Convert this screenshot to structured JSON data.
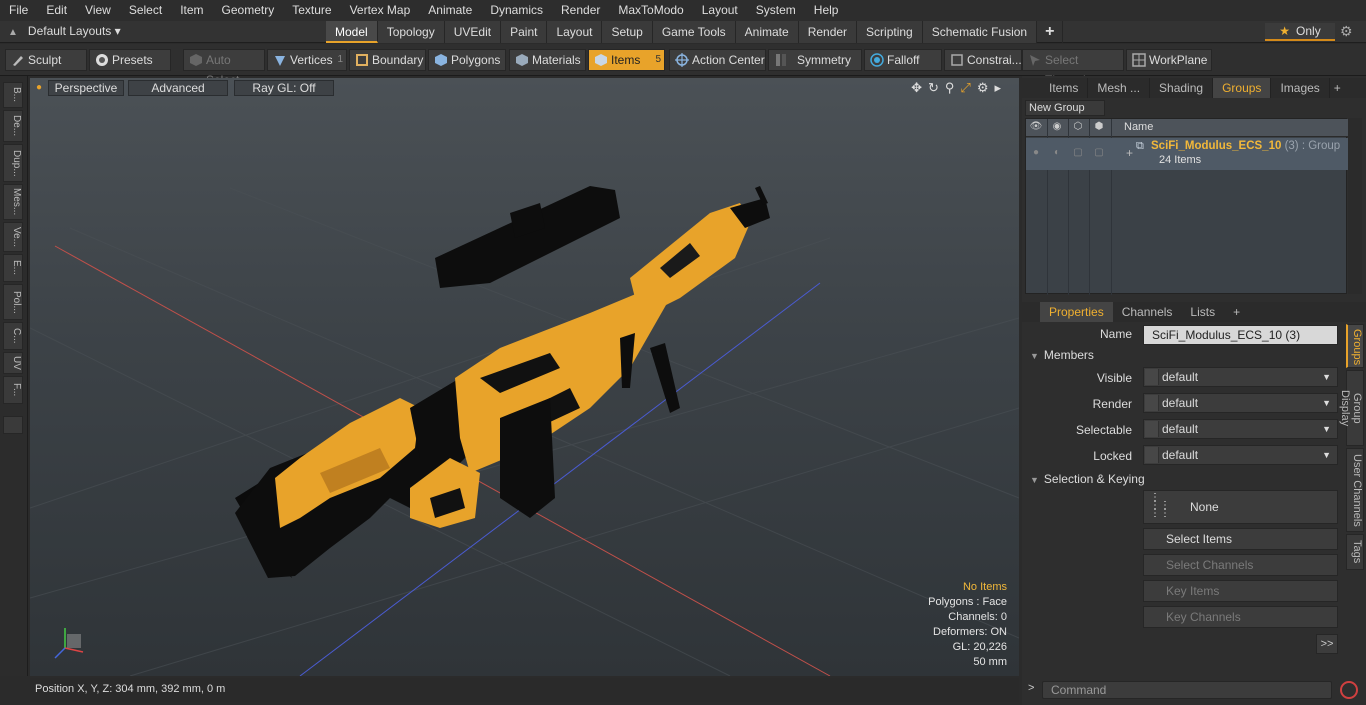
{
  "menu": [
    "File",
    "Edit",
    "View",
    "Select",
    "Item",
    "Geometry",
    "Texture",
    "Vertex Map",
    "Animate",
    "Dynamics",
    "Render",
    "MaxToModo",
    "Layout",
    "System",
    "Help"
  ],
  "layout_selector": "Default Layouts",
  "mode_tabs": [
    {
      "label": "Model",
      "active": true
    },
    {
      "label": "Topology"
    },
    {
      "label": "UVEdit"
    },
    {
      "label": "Paint"
    },
    {
      "label": "Layout"
    },
    {
      "label": "Setup"
    },
    {
      "label": "Game Tools"
    },
    {
      "label": "Animate"
    },
    {
      "label": "Render"
    },
    {
      "label": "Scripting"
    },
    {
      "label": "Schematic Fusion"
    }
  ],
  "only_label": "Only",
  "toolbar": {
    "sculpt": "Sculpt",
    "presets": "Presets",
    "auto_select": "Auto Select",
    "vertices": "Vertices",
    "vertices_count": "1",
    "boundary": "Boundary",
    "polygons": "Polygons",
    "materials": "Materials",
    "items": "Items",
    "items_count": "5",
    "action_center": "Action Center",
    "symmetry": "Symmetry",
    "falloff": "Falloff",
    "constraints": "Constrai...",
    "select_through": "Select Through",
    "workplane": "WorkPlane"
  },
  "left_strip": [
    "B...",
    "De...",
    "Dup...",
    "Mes...",
    "Ve...",
    "E...",
    "Pol...",
    "C...",
    "UV",
    "F..."
  ],
  "viewport": {
    "perspective": "Perspective",
    "advanced": "Advanced",
    "raygl": "Ray GL: Off",
    "info": {
      "items": "No Items",
      "polygons": "Polygons : Face",
      "channels": "Channels: 0",
      "deformers": "Deformers: ON",
      "gl": "GL: 20,226",
      "scale": "50 mm"
    }
  },
  "status": "Position X, Y, Z:   304 mm, 392 mm, 0 m",
  "right_tabs": [
    "Items",
    "Mesh ...",
    "Shading",
    "Groups",
    "Images"
  ],
  "groups": {
    "new_group": "New Group",
    "name_header": "Name",
    "row_name": "SciFi_Modulus_ECS_10",
    "row_suffix": " (3) : Group",
    "row_count": "24 Items"
  },
  "prop_tabs": [
    "Properties",
    "Channels",
    "Lists"
  ],
  "props": {
    "name_label": "Name",
    "name_value": "SciFi_Modulus_ECS_10 (3)",
    "members": "Members",
    "visible_label": "Visible",
    "visible_value": "default",
    "render_label": "Render",
    "render_value": "default",
    "selectable_label": "Selectable",
    "selectable_value": "default",
    "locked_label": "Locked",
    "locked_value": "default",
    "selkey": "Selection & Keying",
    "none": "None",
    "select_items": "Select Items",
    "select_channels": "Select Channels",
    "key_items": "Key Items",
    "key_channels": "Key Channels",
    "more": ">>"
  },
  "side_tabs": [
    "Groups",
    "Group Display",
    "User Channels",
    "Tags"
  ],
  "command_placeholder": "Command",
  "colors": {
    "accent": "#e8a32a",
    "highlight_text": "#f2b83a"
  }
}
